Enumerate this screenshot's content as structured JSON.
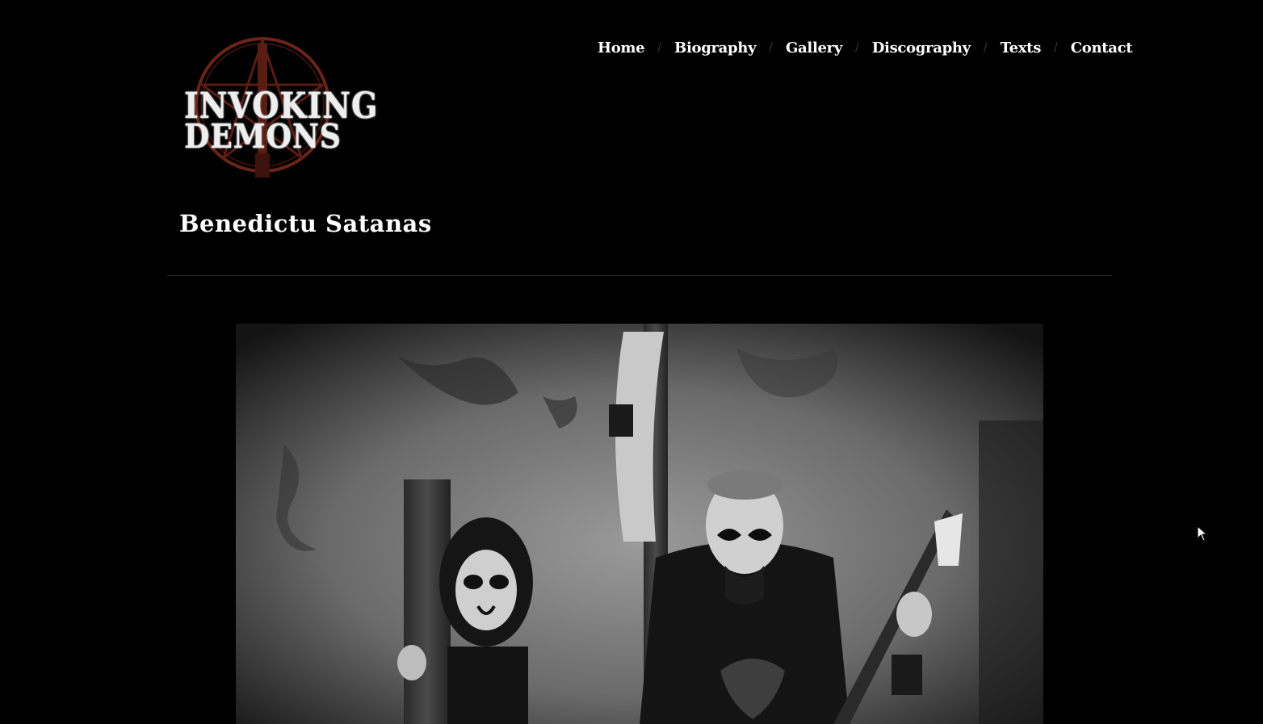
{
  "logo": {
    "line1": "INVOKING",
    "line2": "DEMONS",
    "icon": "pentagram-emblem",
    "accent_color": "#6b2418"
  },
  "nav": {
    "items": [
      {
        "label": "Home"
      },
      {
        "label": "Biography"
      },
      {
        "label": "Gallery"
      },
      {
        "label": "Discography"
      },
      {
        "label": "Texts"
      },
      {
        "label": "Contact"
      }
    ],
    "separator": "/"
  },
  "page": {
    "title": "Benedictu Satanas"
  },
  "photo": {
    "description_icon": "band-photo"
  },
  "colors": {
    "background": "#000000",
    "text": "#ffffff",
    "separator": "#3a3a3a",
    "divider": "#2a2a2a"
  }
}
